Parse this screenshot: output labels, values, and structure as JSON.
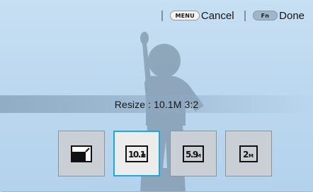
{
  "topbar": {
    "cancel_key": "MENU",
    "cancel_label": "Cancel",
    "done_key": "Fn",
    "done_label": "Done"
  },
  "status": {
    "resize_text": "Resize : 10.1M 3:2"
  },
  "options": [
    {
      "icon": "crop-resize-icon",
      "label": ""
    },
    {
      "icon": "size-10-1m-icon",
      "label": "10.1M",
      "selected": true
    },
    {
      "icon": "size-5-9m-icon",
      "label": "5.9M"
    },
    {
      "icon": "size-2m-icon",
      "label": "2M"
    }
  ],
  "colors": {
    "accent_selected": "#1ea7de",
    "background": "#bcd8ef"
  }
}
